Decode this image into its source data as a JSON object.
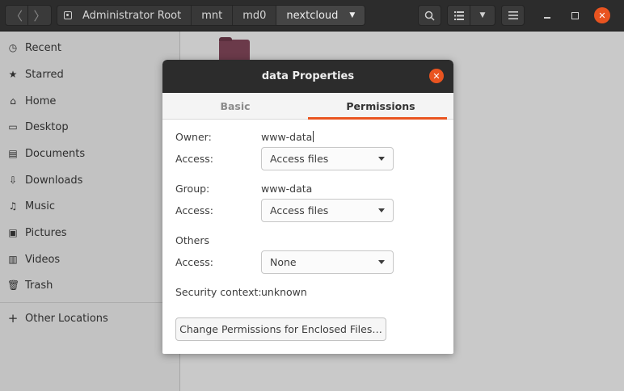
{
  "header": {
    "back_icon": "chevron-left-icon",
    "forward_icon": "chevron-right-icon",
    "breadcrumbs": [
      "Administrator Root",
      "mnt",
      "md0",
      "nextcloud"
    ],
    "breadcrumb_menu_icon": "chevron-down-icon",
    "search_icon": "search-icon",
    "view_icon": "list-view-icon",
    "menu_icon": "hamburger-icon"
  },
  "sidebar": {
    "items": [
      {
        "label": "Recent",
        "icon": "clock-icon"
      },
      {
        "label": "Starred",
        "icon": "star-icon"
      },
      {
        "label": "Home",
        "icon": "home-icon"
      },
      {
        "label": "Desktop",
        "icon": "desktop-icon"
      },
      {
        "label": "Documents",
        "icon": "document-icon"
      },
      {
        "label": "Downloads",
        "icon": "download-icon"
      },
      {
        "label": "Music",
        "icon": "music-icon"
      },
      {
        "label": "Pictures",
        "icon": "picture-icon"
      },
      {
        "label": "Videos",
        "icon": "video-icon"
      },
      {
        "label": "Trash",
        "icon": "trash-icon"
      }
    ],
    "other_locations": {
      "label": "Other Locations",
      "icon": "plus-icon"
    }
  },
  "dialog": {
    "title": "data Properties",
    "tabs": [
      "Basic",
      "Permissions"
    ],
    "active_tab": "Permissions",
    "owner_label": "Owner:",
    "owner_value": "www-data",
    "owner_access_label": "Access:",
    "owner_access_value": "Access files",
    "group_label": "Group:",
    "group_value": "www-data",
    "group_access_label": "Access:",
    "group_access_value": "Access files",
    "others_label": "Others",
    "others_access_label": "Access:",
    "others_access_value": "None",
    "security_label": "Security context:",
    "security_value": "unknown",
    "enclosed_button_label": "Change Permissions for Enclosed Files…"
  },
  "colors": {
    "accent": "#e95420",
    "headerbar": "#2c2c2c",
    "sidebar": "#c2c2c2"
  }
}
